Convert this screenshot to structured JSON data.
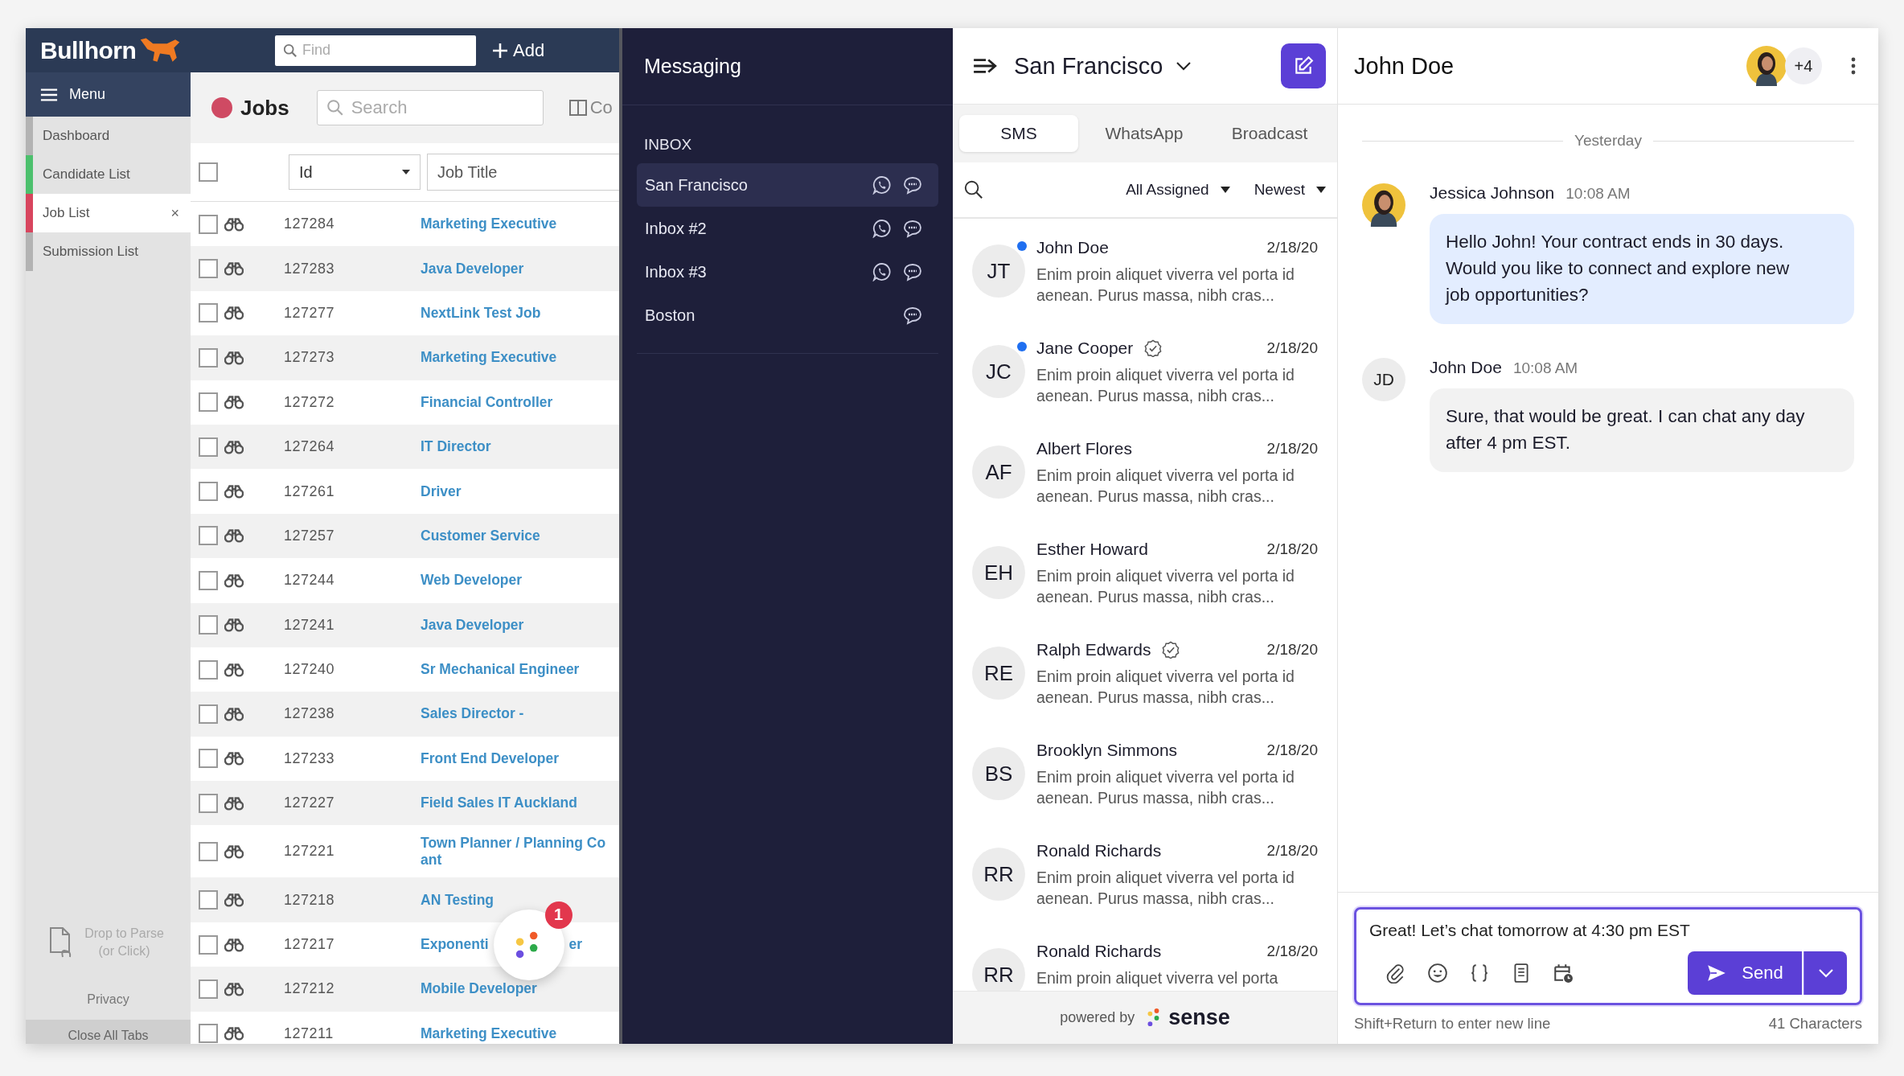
{
  "bullhorn": {
    "logo": "Bullhorn",
    "find_placeholder": "Find",
    "add_button": "Add",
    "menu": "Menu",
    "sidebar_items": [
      {
        "label": "Dashboard",
        "selected": false,
        "color": "#b3b3b3"
      },
      {
        "label": "Candidate List",
        "selected": false,
        "color": "#4cc06d"
      },
      {
        "label": "Job List",
        "selected": true,
        "color": "#d8455e",
        "close": "×"
      },
      {
        "label": "Submission List",
        "selected": false,
        "color": "#b3b3b3"
      }
    ],
    "drop_hint": "Drop to Parse (or Click)",
    "privacy": "Privacy",
    "close_all": "Close All Tabs"
  },
  "jobs": {
    "title": "Jobs",
    "search_placeholder": "Search",
    "columns_button": "Co",
    "select_all_checked": false,
    "columns": [
      {
        "label": "Id",
        "kind": "select"
      },
      {
        "label": "Job Title",
        "kind": "text"
      }
    ],
    "rows": [
      {
        "id": "127284",
        "title": "Marketing Executive",
        "checked": false
      },
      {
        "id": "127283",
        "title": "Java Developer",
        "checked": false
      },
      {
        "id": "127277",
        "title": "NextLink Test Job",
        "checked": false
      },
      {
        "id": "127273",
        "title": "Marketing Executive",
        "checked": false
      },
      {
        "id": "127272",
        "title": "Financial Controller",
        "checked": false
      },
      {
        "id": "127264",
        "title": "IT Director",
        "checked": false
      },
      {
        "id": "127261",
        "title": "Driver",
        "checked": false
      },
      {
        "id": "127257",
        "title": "Customer Service",
        "checked": false
      },
      {
        "id": "127244",
        "title": "Web Developer",
        "checked": false
      },
      {
        "id": "127241",
        "title": "Java Developer",
        "checked": false
      },
      {
        "id": "127240",
        "title": "Sr Mechanical Engineer",
        "checked": false
      },
      {
        "id": "127238",
        "title": "Sales Director -",
        "checked": false
      },
      {
        "id": "127233",
        "title": "Front End Developer",
        "checked": false
      },
      {
        "id": "127227",
        "title": "Field Sales IT Auckland",
        "checked": false
      },
      {
        "id": "127221",
        "title": "Town Planner / Planning Co",
        "title_2": "ant",
        "kind": "wrapped",
        "checked": false
      },
      {
        "id": "127218",
        "title": "AN Testing",
        "checked": false
      },
      {
        "id": "127217",
        "title": "Exponenti",
        "title_2": "er",
        "kind": "covered",
        "checked": false
      },
      {
        "id": "127212",
        "title": "Mobile Developer",
        "checked": false
      },
      {
        "id": "127211",
        "title": "Marketing Executive",
        "checked": false
      }
    ],
    "float_badge": "1"
  },
  "messaging": {
    "title": "Messaging",
    "section": "INBOX",
    "inboxes": [
      {
        "label": "San Francisco",
        "selected": true,
        "channels": [
          {
            "kind": "whatsapp"
          },
          {
            "kind": "sms"
          }
        ]
      },
      {
        "label": "Inbox #2",
        "selected": false,
        "channels": [
          {
            "kind": "whatsapp"
          },
          {
            "kind": "sms"
          }
        ]
      },
      {
        "label": "Inbox #3",
        "selected": false,
        "channels": [
          {
            "kind": "whatsapp"
          },
          {
            "kind": "sms"
          }
        ]
      },
      {
        "label": "Boston",
        "selected": false,
        "channels": [
          {
            "kind": "sms"
          }
        ]
      }
    ]
  },
  "conversations": {
    "inbox": "San Francisco",
    "tabs": [
      {
        "label": "SMS",
        "selected": true
      },
      {
        "label": "WhatsApp",
        "selected": false
      },
      {
        "label": "Broadcast",
        "selected": false
      }
    ],
    "filters": [
      "All Assigned",
      "Newest"
    ],
    "items": [
      {
        "initials": "JT",
        "name": "John Doe",
        "date": "2/18/20",
        "preview": "Enim proin aliquet viverra vel porta id aenean. Purus massa, nibh cras...",
        "unread": true,
        "verified": false
      },
      {
        "initials": "JC",
        "name": "Jane Cooper",
        "date": "2/18/20",
        "preview": "Enim proin aliquet viverra vel porta id aenean. Purus massa, nibh cras...",
        "unread": true,
        "verified": true
      },
      {
        "initials": "AF",
        "name": "Albert Flores",
        "date": "2/18/20",
        "preview": "Enim proin aliquet viverra vel porta id aenean. Purus massa, nibh cras...",
        "unread": false,
        "verified": false
      },
      {
        "initials": "EH",
        "name": "Esther Howard",
        "date": "2/18/20",
        "preview": "Enim proin aliquet viverra vel porta id aenean. Purus massa, nibh cras...",
        "unread": false,
        "verified": false
      },
      {
        "initials": "RE",
        "name": "Ralph Edwards",
        "date": "2/18/20",
        "preview": "Enim proin aliquet viverra vel porta id aenean. Purus massa, nibh cras...",
        "unread": false,
        "verified": true
      },
      {
        "initials": "BS",
        "name": "Brooklyn Simmons",
        "date": "2/18/20",
        "preview": "Enim proin aliquet viverra vel porta id aenean. Purus massa, nibh cras...",
        "unread": false,
        "verified": false
      },
      {
        "initials": "RR",
        "name": "Ronald Richards",
        "date": "2/18/20",
        "preview": "Enim proin aliquet viverra vel porta id aenean. Purus massa, nibh cras...",
        "unread": false,
        "verified": false
      },
      {
        "initials": "RR",
        "name": "Ronald Richards",
        "date": "2/18/20",
        "preview": "Enim proin aliquet viverra vel porta",
        "unread": false,
        "verified": false
      }
    ],
    "powered_by": "powered by",
    "brand": "sense"
  },
  "chat": {
    "title": "John Doe",
    "more_participants": "+4",
    "divider": "Yesterday",
    "messages": [
      {
        "kind": "agent",
        "sender": "Jessica Johnson",
        "time": "10:08 AM",
        "text": "Hello John! Your contract ends in 30 days. Would you like to connect and explore new job opportunities?"
      },
      {
        "kind": "contact",
        "initials": "JD",
        "sender": "John Doe",
        "time": "10:08 AM",
        "text": "Sure, that would be great. I can chat any day after 4 pm EST."
      }
    ],
    "composer": {
      "value": "Great! Let’s chat tomorrow at 4:30 pm EST",
      "send": "Send",
      "hint": "Shift+Return to enter new line",
      "count": "41 Characters"
    }
  }
}
